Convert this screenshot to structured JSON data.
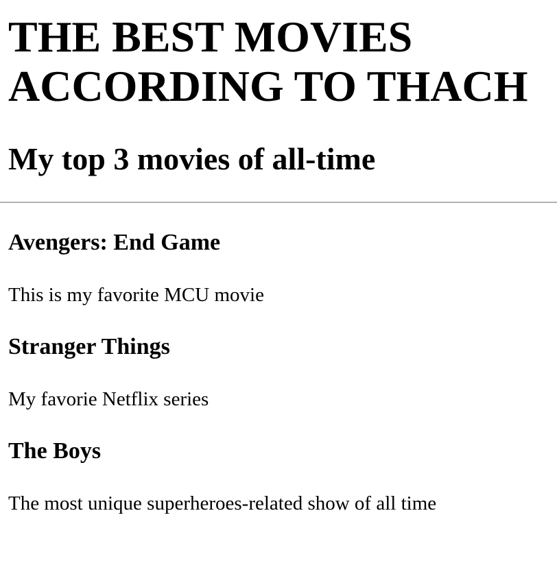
{
  "page": {
    "title_line1": "THE BEST MOVIES",
    "title_line2": "ACCORDING TO THACH",
    "subtitle": "My top 3 movies of all-time"
  },
  "movies": [
    {
      "title": "Avengers: End Game",
      "description": "This is my favorite MCU movie"
    },
    {
      "title": "Stranger Things",
      "description": "My favorie Netflix series"
    },
    {
      "title": "The Boys",
      "description": "The most unique superheroes-related show of all time"
    }
  ],
  "colors": {
    "text": "#000000",
    "divider": "#b3b3b3",
    "background": "#ffffff"
  }
}
